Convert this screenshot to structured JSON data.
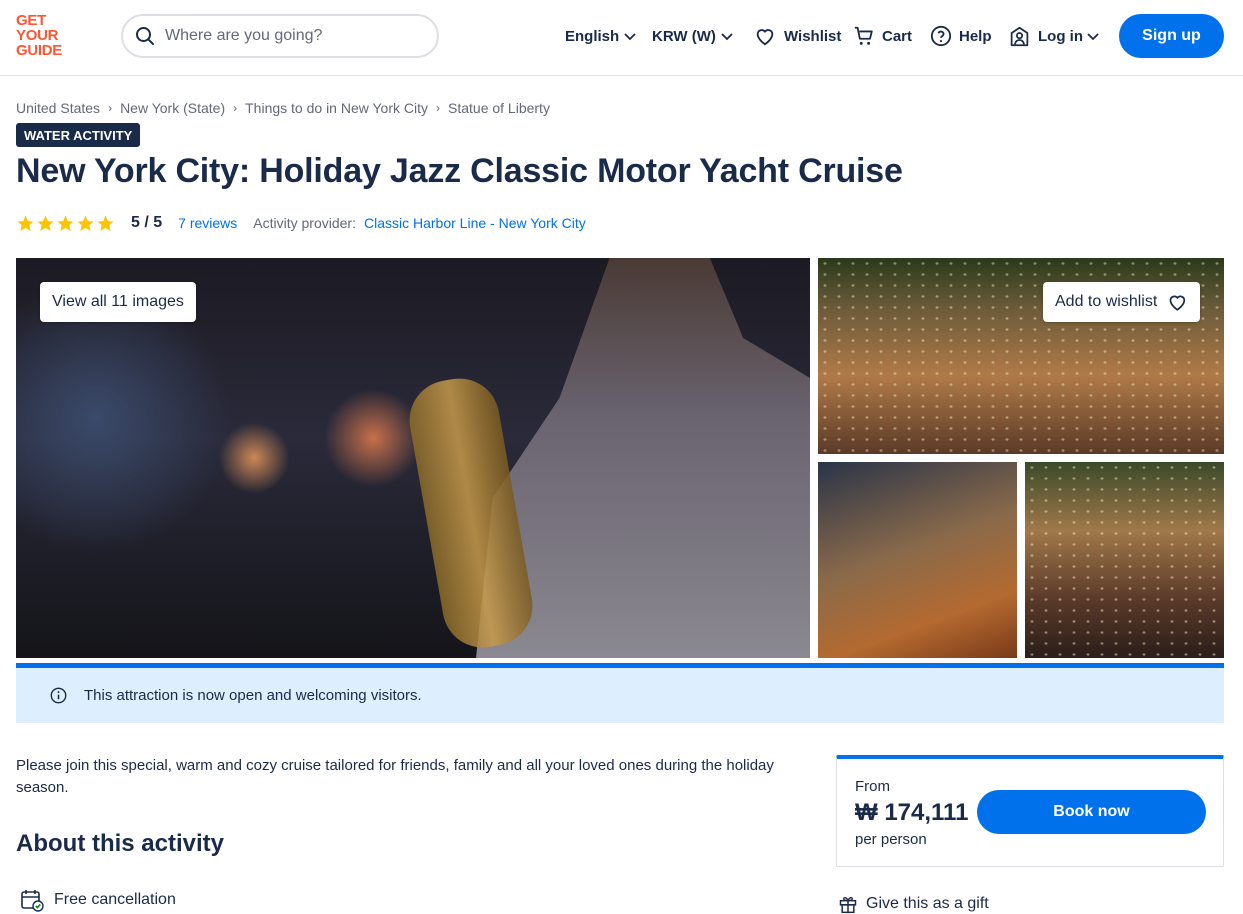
{
  "brand": {
    "logo_lines": [
      "GET",
      "YOUR",
      "GUIDE"
    ],
    "color": "#ff5533",
    "accent": "#0071eb"
  },
  "search": {
    "placeholder": "Where are you going?"
  },
  "nav": {
    "language": "English",
    "currency": "KRW (W)",
    "wishlist": "Wishlist",
    "cart": "Cart",
    "help": "Help",
    "login": "Log in",
    "signup": "Sign up"
  },
  "breadcrumb": [
    "United States",
    "New York (State)",
    "Things to do in New York City",
    "Statue of Liberty"
  ],
  "activity": {
    "badge": "WATER ACTIVITY",
    "title": "New York City: Holiday Jazz Classic Motor Yacht Cruise",
    "stars": 5,
    "score": "5 / 5",
    "reviews": "7 reviews",
    "provider_label": "Activity provider:",
    "provider": "Classic Harbor Line - New York City"
  },
  "gallery": {
    "view_all": "View all 11 images",
    "add_wishlist": "Add to wishlist"
  },
  "notice": {
    "text": "This attraction is now open and welcoming visitors."
  },
  "description": "Please join this special, warm and cozy cruise tailored for friends, family and all your loved ones during the holiday season.",
  "about": {
    "heading": "About this activity",
    "features": [
      "Free cancellation"
    ]
  },
  "booking": {
    "from": "From",
    "price": "₩ 174,111",
    "per": "per person",
    "book_now": "Book now",
    "gift": "Give this as a gift"
  }
}
